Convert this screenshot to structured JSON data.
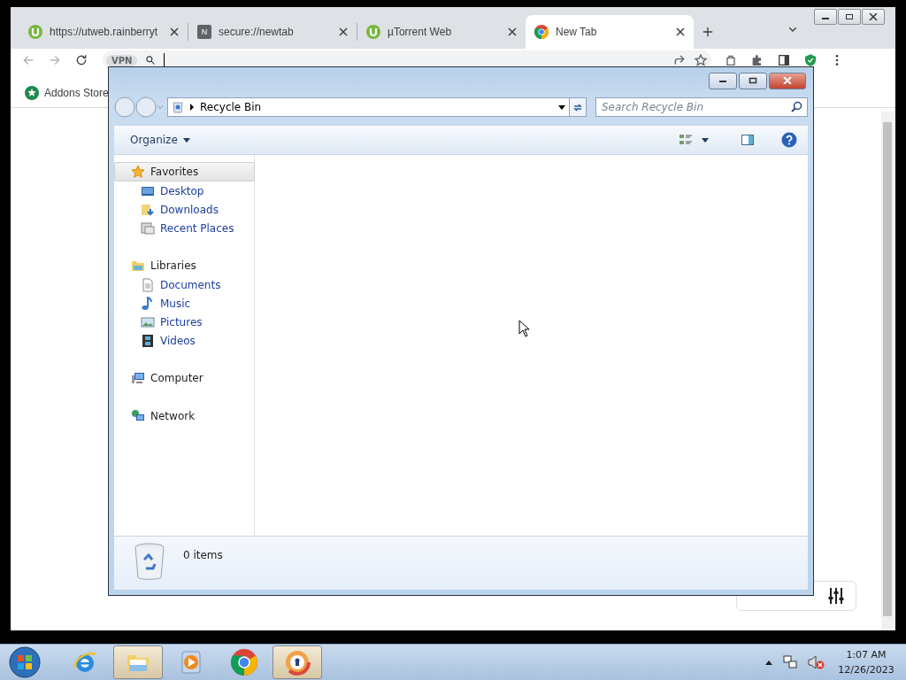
{
  "browser": {
    "tabs": [
      {
        "title": "https://utweb.rainberryt",
        "kind": "utorrent",
        "selected": false
      },
      {
        "title": "secure://newtab",
        "kind": "letter",
        "letter": "N",
        "selected": false
      },
      {
        "title": "µTorrent Web",
        "kind": "utorrent",
        "selected": false
      },
      {
        "title": "New Tab",
        "kind": "chrome",
        "selected": true
      }
    ],
    "vpn_badge": "VPN",
    "bookmarks": [
      {
        "label": "Addons Store"
      }
    ]
  },
  "explorer": {
    "location": "Recycle Bin",
    "search": {
      "placeholder": "Search Recycle Bin"
    },
    "toolbar": {
      "organize": "Organize"
    },
    "nav": [
      {
        "label": "Favorites",
        "kind": "star",
        "selected": true,
        "children": [
          {
            "label": "Desktop",
            "kind": "desktop"
          },
          {
            "label": "Downloads",
            "kind": "downloads"
          },
          {
            "label": "Recent Places",
            "kind": "recent"
          }
        ]
      },
      {
        "label": "Libraries",
        "kind": "libraries",
        "selected": false,
        "children": [
          {
            "label": "Documents",
            "kind": "document"
          },
          {
            "label": "Music",
            "kind": "music"
          },
          {
            "label": "Pictures",
            "kind": "pictures"
          },
          {
            "label": "Videos",
            "kind": "videos"
          }
        ]
      },
      {
        "label": "Computer",
        "kind": "computer",
        "selected": false
      },
      {
        "label": "Network",
        "kind": "network",
        "selected": false
      }
    ],
    "status": "0 items"
  },
  "taskbar": {
    "apps": [
      {
        "kind": "ie",
        "selected": false
      },
      {
        "kind": "explorer",
        "selected": true
      },
      {
        "kind": "media",
        "selected": false
      },
      {
        "kind": "chrome",
        "selected": false
      },
      {
        "kind": "secure-browser",
        "selected": true
      }
    ],
    "time": "1:07 AM",
    "date": "12/26/2023"
  }
}
